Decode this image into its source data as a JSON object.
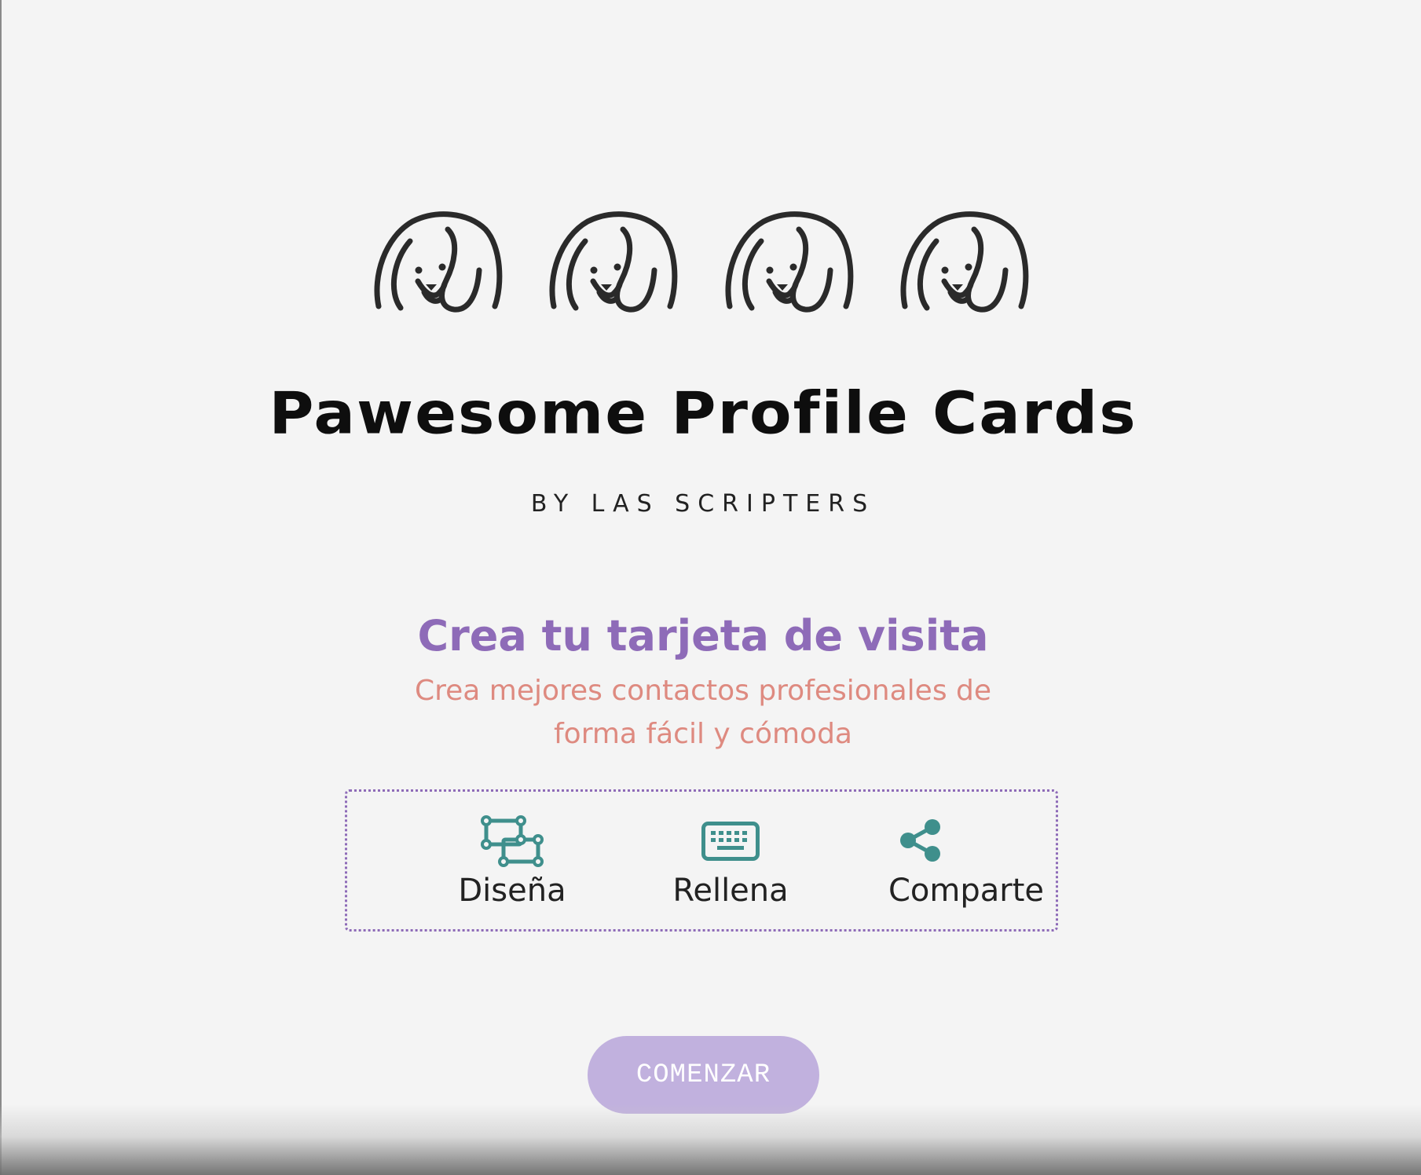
{
  "brand": {
    "title": "Pawesome Profile Cards",
    "subtitle": "BY LAS SCRIPTERS",
    "logo_icons": [
      "dog-icon",
      "dog-icon",
      "dog-icon",
      "dog-icon"
    ]
  },
  "hero": {
    "headline": "Crea tu tarjeta de visita",
    "subline_1": "Crea mejores contactos profesionales de",
    "subline_2": "forma fácil y cómoda"
  },
  "steps": [
    {
      "label": "Diseña",
      "icon": "design-shapes-icon"
    },
    {
      "label": "Rellena",
      "icon": "keyboard-icon"
    },
    {
      "label": "Comparte",
      "icon": "share-icon"
    }
  ],
  "actions": {
    "start_label": "COMENZAR"
  },
  "colors": {
    "headline": "#8e6bb8",
    "subline": "#de8a80",
    "icon_teal": "#3f8f8c",
    "button_bg": "#c1b1de",
    "border_dotted": "#8e6bb8",
    "background": "#f4f4f4"
  }
}
